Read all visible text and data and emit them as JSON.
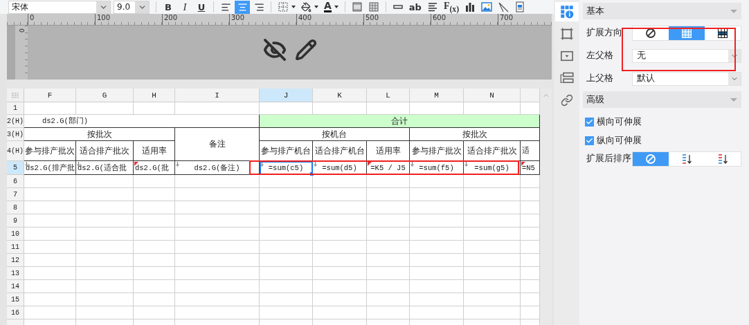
{
  "toolbar": {
    "font_family": {
      "value": "宋体"
    },
    "font_size": {
      "value": "9.0"
    },
    "tools": [
      {
        "kind": "bold",
        "label": "B",
        "selected": false
      },
      {
        "kind": "italic",
        "label": "I",
        "selected": false
      },
      {
        "kind": "underline",
        "label": "U",
        "selected": false
      },
      {
        "kind": "separator"
      },
      {
        "kind": "align-left",
        "selected": false
      },
      {
        "kind": "align-center",
        "selected": true
      },
      {
        "kind": "align-right",
        "selected": false
      },
      {
        "kind": "separator"
      },
      {
        "kind": "border"
      },
      {
        "kind": "fill"
      },
      {
        "kind": "font-color",
        "label": "A"
      },
      {
        "kind": "separator"
      },
      {
        "kind": "merge"
      },
      {
        "kind": "split"
      },
      {
        "kind": "separator"
      },
      {
        "kind": "textfield"
      },
      {
        "kind": "text",
        "label": "ab"
      },
      {
        "kind": "paragraph"
      },
      {
        "kind": "formula",
        "label": "F$_{(x)}$"
      },
      {
        "kind": "chart"
      },
      {
        "kind": "image"
      },
      {
        "kind": "slash"
      },
      {
        "kind": "subreport"
      }
    ]
  },
  "ruler": {
    "marks": [
      "0",
      "100",
      "200",
      "300",
      "400",
      "500",
      "600",
      "700"
    ],
    "vertical_mark": "0"
  },
  "sheet": {
    "highlighted": true,
    "columns": [
      {
        "label": "F",
        "selected": false
      },
      {
        "label": "G",
        "selected": false
      },
      {
        "label": "H",
        "selected": false
      },
      {
        "label": "I",
        "selected": false
      },
      {
        "label": "J",
        "selected": true
      },
      {
        "label": "K",
        "selected": false
      },
      {
        "label": "L",
        "selected": false
      },
      {
        "label": "M",
        "selected": false
      },
      {
        "label": "N",
        "selected": false
      },
      {
        "selected": false
      }
    ],
    "rows": [
      {
        "label": "1",
        "selected": false
      },
      {
        "label": "2(H)",
        "selected": false
      },
      {
        "label": "3(H)",
        "selected": false
      },
      {
        "label": "4(H)",
        "selected": false
      },
      {
        "label": "5",
        "selected": true
      },
      {
        "label": "6",
        "selected": false
      },
      {
        "label": "7",
        "selected": false
      },
      {
        "label": "8",
        "selected": false
      },
      {
        "label": "9",
        "selected": false
      },
      {
        "label": "10",
        "selected": false
      },
      {
        "label": "11",
        "selected": false
      },
      {
        "label": "12",
        "selected": false
      },
      {
        "label": "13",
        "selected": false
      },
      {
        "label": "14",
        "selected": false
      },
      {
        "label": "15",
        "selected": false
      },
      {
        "label": "16",
        "selected": false
      }
    ],
    "cells": [
      {
        "text": "ds2.G(部门)",
        "kind": "title",
        "selected": false
      },
      {
        "text": "合计",
        "kind": "header",
        "color": "#ccffcc",
        "selected": false
      },
      {
        "text": "按批次",
        "kind": "header",
        "selected": false
      },
      {
        "text": "备注",
        "kind": "header",
        "selected": false
      },
      {
        "text": "按机台",
        "kind": "header",
        "selected": false
      },
      {
        "text": "按批次",
        "kind": "header",
        "selected": false
      },
      {
        "text": "参与排产批次",
        "kind": "header",
        "selected": false
      },
      {
        "text": "适合排产批次",
        "kind": "header",
        "selected": false
      },
      {
        "text": "适用率",
        "kind": "header",
        "selected": false
      },
      {
        "text": "参与排产机台",
        "kind": "header",
        "selected": false
      },
      {
        "text": "适合排产机台",
        "kind": "header",
        "selected": false
      },
      {
        "text": "适用率",
        "kind": "header",
        "selected": false
      },
      {
        "text": "参与排产批次",
        "kind": "header",
        "selected": false
      },
      {
        "text": "适合排产批次",
        "kind": "header",
        "selected": false
      },
      {
        "text": "适",
        "kind": "clipped",
        "selected": false
      },
      {
        "text": "ds2.G(排产批",
        "kind": "clipped",
        "expandable": true,
        "flagged": false,
        "selected": false
      },
      {
        "text": "ds2.G(适合批",
        "kind": "clipped",
        "expandable": true,
        "flagged": false,
        "selected": false
      },
      {
        "text": "ds2.G(批",
        "kind": "clipped",
        "expandable": false,
        "flagged": true,
        "selected": false
      },
      {
        "text": "ds2.G(备注)",
        "kind": "data",
        "expandable": true,
        "flagged": false,
        "selected": false
      },
      {
        "text": "=sum(c5)",
        "kind": "data",
        "expandable": true,
        "flagged": false,
        "selected": true
      },
      {
        "text": "=sum(d5)",
        "kind": "data",
        "expandable": true,
        "flagged": false,
        "selected": false
      },
      {
        "text": "=K5 / J5",
        "kind": "data",
        "expandable": false,
        "flagged": true,
        "selected": false
      },
      {
        "text": "=sum(f5)",
        "kind": "data",
        "expandable": true,
        "flagged": false,
        "selected": false
      },
      {
        "text": "=sum(g5)",
        "kind": "data",
        "expandable": true,
        "flagged": false,
        "selected": false
      },
      {
        "text": "=N5",
        "kind": "clipped",
        "expandable": false,
        "flagged": true,
        "selected": false
      }
    ]
  },
  "side_tabs": [
    {
      "kind": "attributes",
      "selected": true
    },
    {
      "kind": "frame",
      "selected": false
    },
    {
      "kind": "widget",
      "selected": false
    },
    {
      "kind": "condition",
      "selected": false
    },
    {
      "kind": "link",
      "selected": false
    }
  ],
  "panel": {
    "sections": [
      {
        "title": "基本",
        "highlighted": true,
        "rows": [
          {
            "kind": "segmented",
            "label": "扩展方向",
            "options": [
              {
                "kind": "none",
                "selected": false
              },
              {
                "kind": "vertical",
                "selected": true
              },
              {
                "kind": "horizontal",
                "selected": false
              }
            ]
          },
          {
            "kind": "select",
            "label": "左父格",
            "value": "无"
          },
          {
            "kind": "select",
            "label": "上父格",
            "value": "默认"
          }
        ]
      },
      {
        "title": "高级",
        "highlighted": false,
        "rows": [
          {
            "kind": "checkbox",
            "label": "横向可伸展",
            "checked": true
          },
          {
            "kind": "checkbox",
            "label": "纵向可伸展",
            "checked": true
          },
          {
            "kind": "segmented",
            "label": "扩展后排序",
            "options": [
              {
                "kind": "none",
                "selected": true
              },
              {
                "kind": "ascending",
                "selected": false
              },
              {
                "kind": "descending",
                "selected": false
              }
            ]
          }
        ]
      }
    ]
  }
}
